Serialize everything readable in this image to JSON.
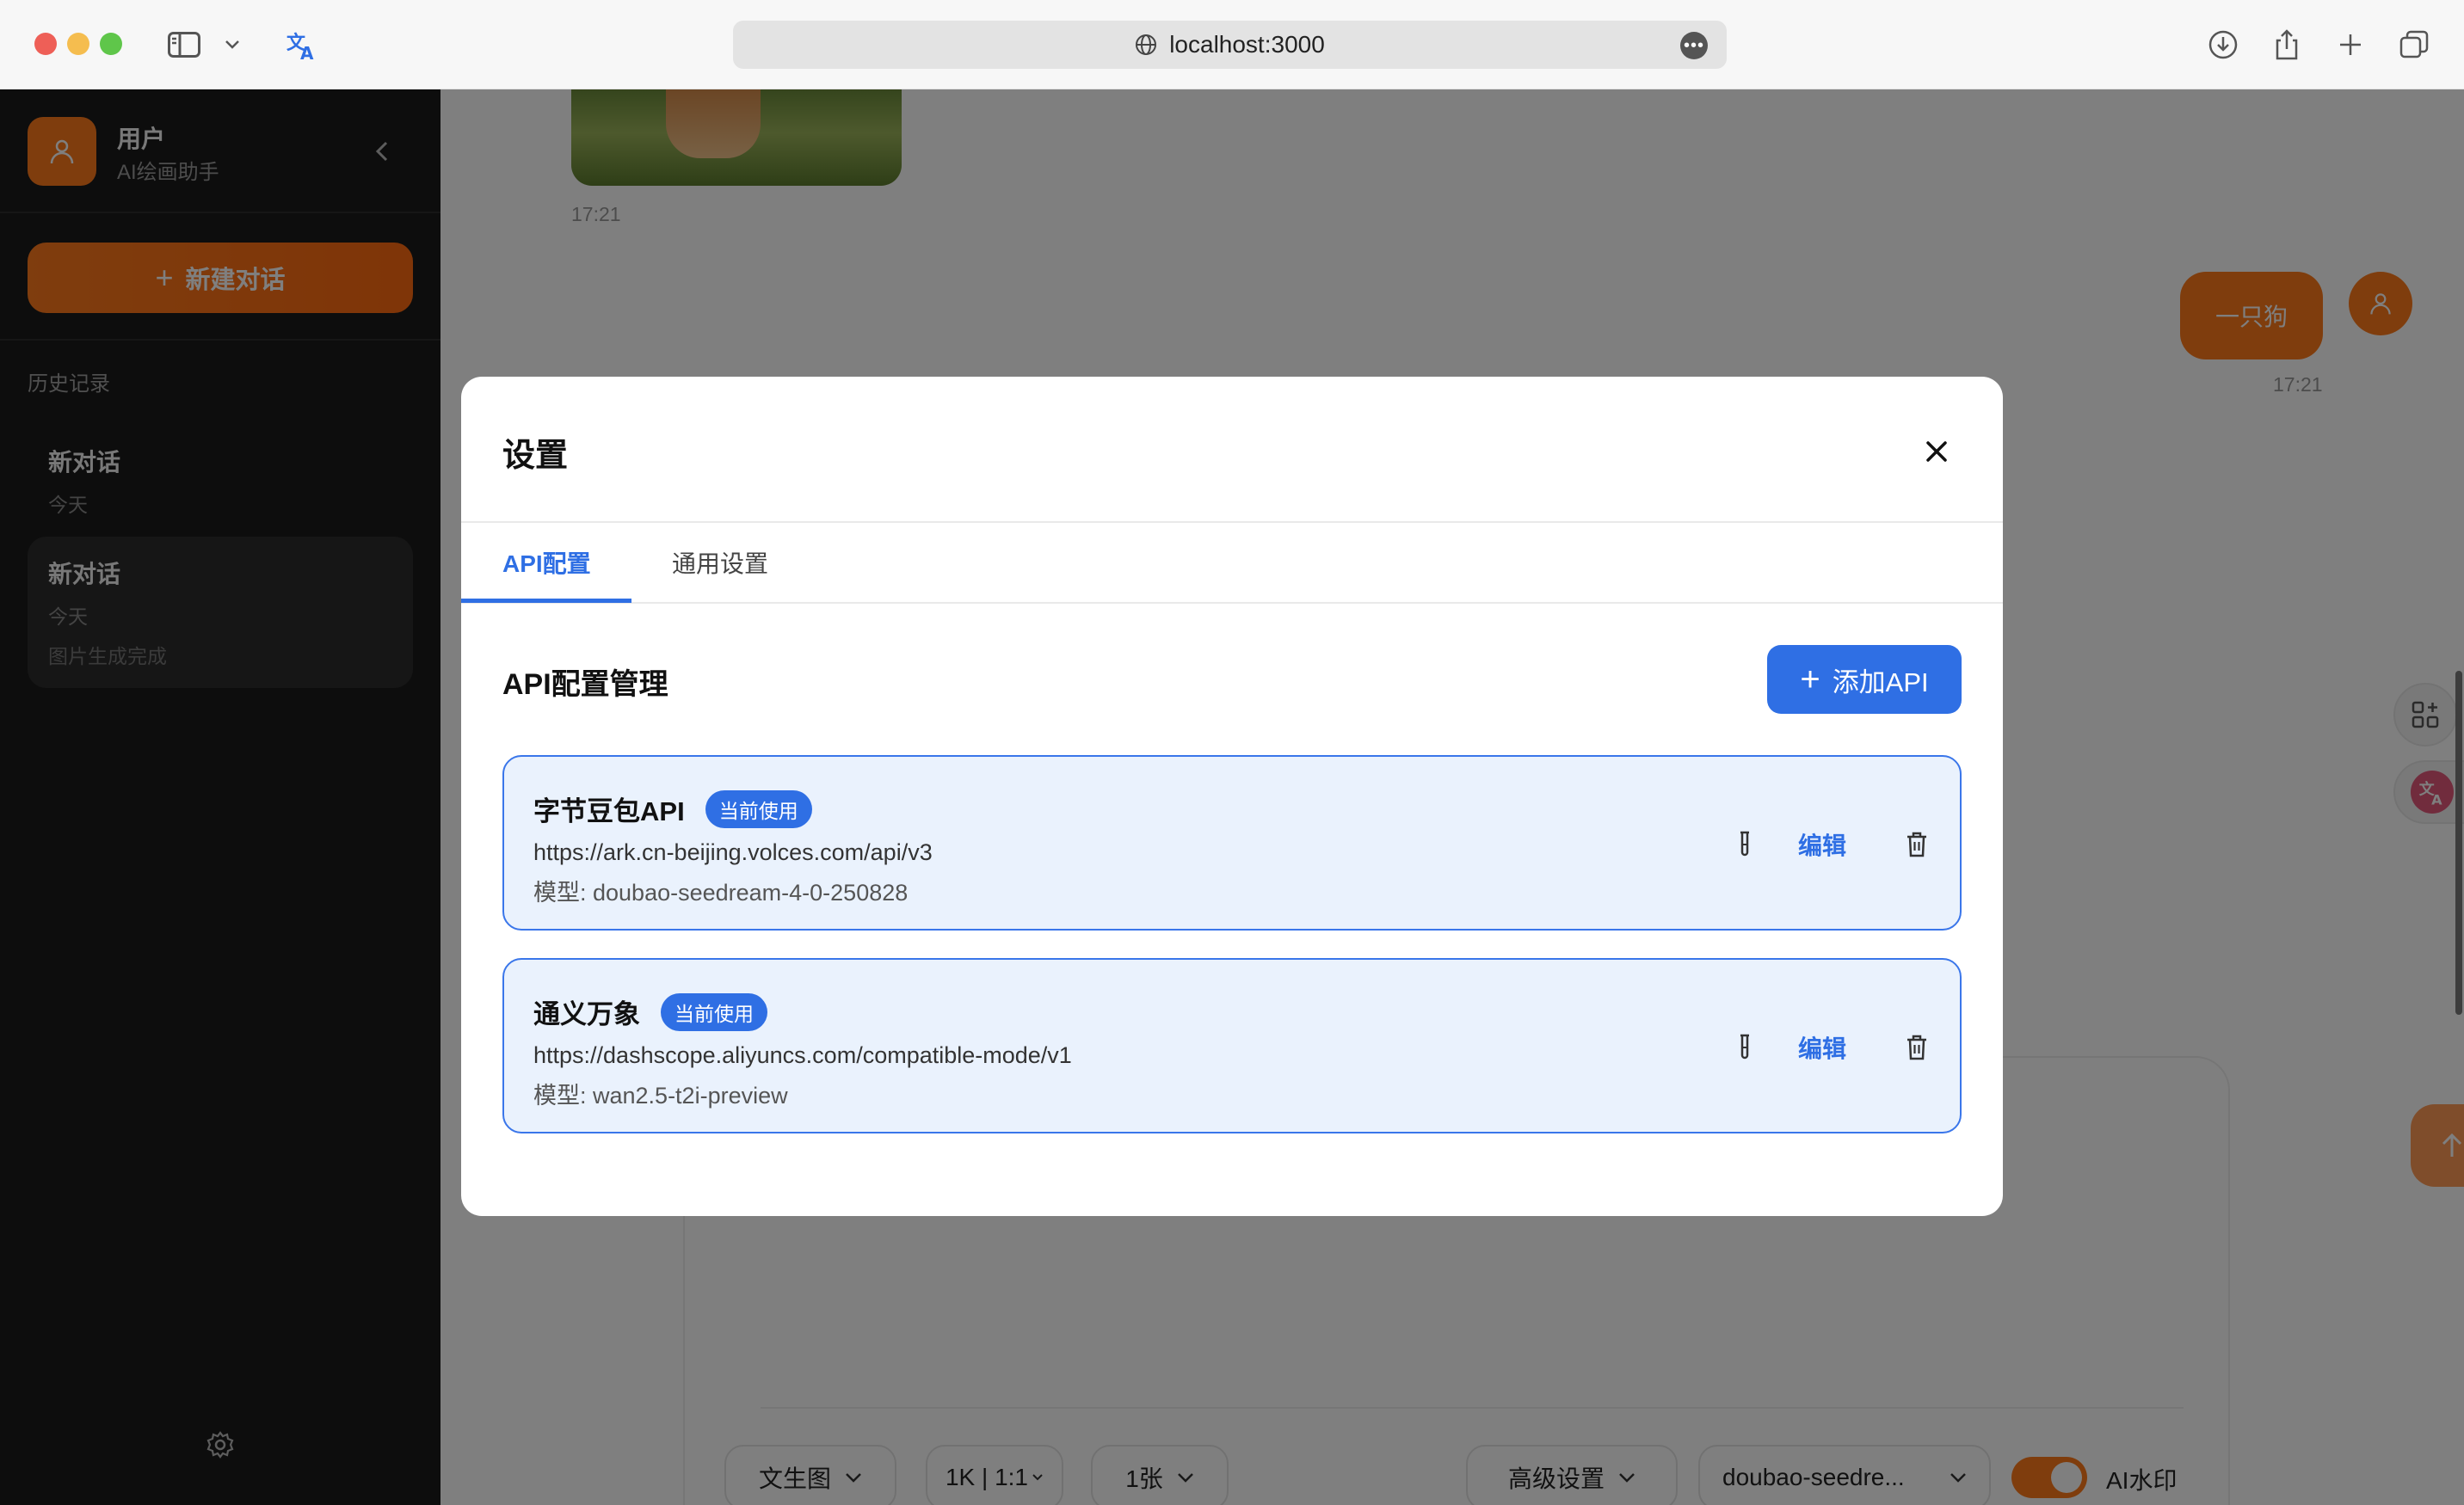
{
  "browser": {
    "url": "localhost:3000"
  },
  "sidebar": {
    "user_name": "用户",
    "user_role": "AI绘画助手",
    "new_chat_label": "新建对话",
    "history_title": "历史记录",
    "history": [
      {
        "title": "新对话",
        "date": "今天",
        "status": ""
      },
      {
        "title": "新对话",
        "date": "今天",
        "status": "图片生成完成"
      }
    ]
  },
  "chat": {
    "image_time": "17:21",
    "user_message": "一只狗",
    "user_message_time": "17:21"
  },
  "composer": {
    "mode_label": "文生图",
    "size_label": "1K | 1:1",
    "count_label": "1张",
    "advanced_label": "高级设置",
    "model_label": "doubao-seedre...",
    "watermark_label": "AI水印",
    "watermark_on": true
  },
  "settings_modal": {
    "title": "设置",
    "tabs": [
      {
        "label": "API配置",
        "active": true
      },
      {
        "label": "通用设置",
        "active": false
      }
    ],
    "section_title": "API配置管理",
    "add_api_label": "添加API",
    "apis": [
      {
        "name": "字节豆包API",
        "badge": "当前使用",
        "url": "https://ark.cn-beijing.volces.com/api/v3",
        "model": "模型: doubao-seedream-4-0-250828",
        "edit_label": "编辑"
      },
      {
        "name": "通义万象",
        "badge": "当前使用",
        "url": "https://dashscope.aliyuncs.com/compatible-mode/v1",
        "model": "模型: wan2.5-t2i-preview",
        "edit_label": "编辑"
      }
    ]
  },
  "colors": {
    "accent_orange": "#ff7a1a",
    "accent_blue": "#2f6fe4",
    "sidebar_bg": "#1b1b1b"
  }
}
